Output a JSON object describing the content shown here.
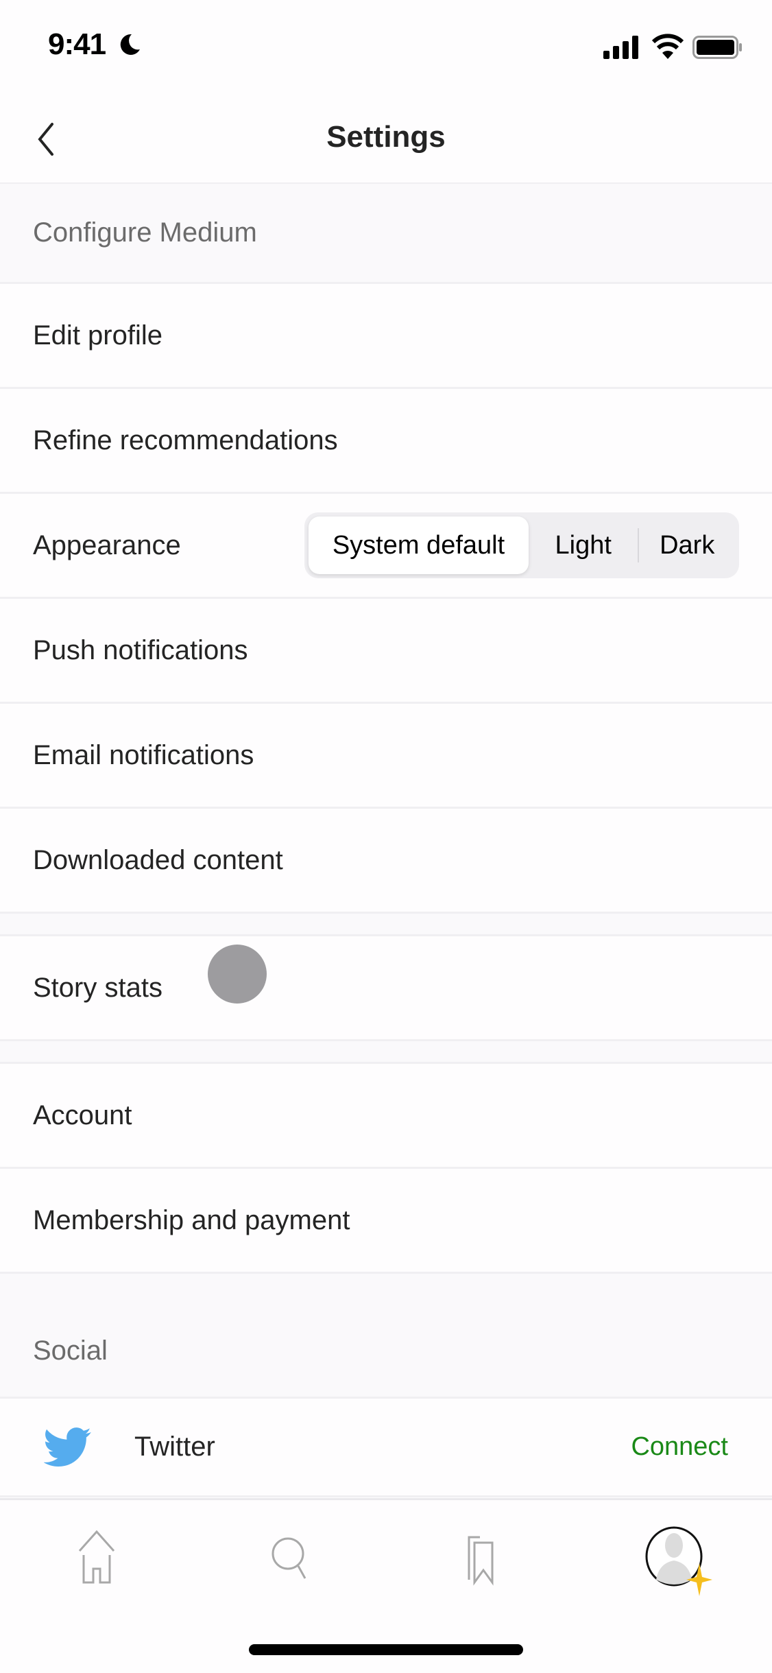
{
  "status_bar": {
    "time": "9:41",
    "icons": [
      "moon-icon",
      "signal-icon",
      "wifi-icon",
      "battery-icon"
    ]
  },
  "header": {
    "title": "Settings",
    "back_icon": "chevron-left-icon"
  },
  "sections": {
    "configure": {
      "header": "Configure Medium",
      "items": [
        {
          "label": "Edit profile"
        },
        {
          "label": "Refine recommendations"
        },
        {
          "label": "Appearance"
        },
        {
          "label": "Push notifications"
        },
        {
          "label": "Email notifications"
        },
        {
          "label": "Downloaded content"
        }
      ]
    },
    "stats": {
      "items": [
        {
          "label": "Story stats"
        }
      ]
    },
    "account": {
      "items": [
        {
          "label": "Account"
        },
        {
          "label": "Membership and payment"
        }
      ]
    },
    "social": {
      "header": "Social",
      "items": [
        {
          "label": "Twitter",
          "icon": "twitter-bird-icon",
          "action": "Connect"
        }
      ]
    }
  },
  "appearance": {
    "options": [
      "System default",
      "Light",
      "Dark"
    ],
    "selected": "System default"
  },
  "tab_bar": {
    "tabs": [
      {
        "name": "home",
        "icon": "home-icon"
      },
      {
        "name": "search",
        "icon": "search-icon"
      },
      {
        "name": "library",
        "icon": "bookmarks-icon"
      },
      {
        "name": "profile",
        "icon": "avatar-icon",
        "selected": true
      }
    ]
  },
  "colors": {
    "accent_green": "#1a8917",
    "twitter_blue": "#55acee",
    "member_star": "#f5be1e",
    "section_bg": "#faf9fb",
    "text_primary": "#242424",
    "text_secondary": "#6b6b6b"
  }
}
